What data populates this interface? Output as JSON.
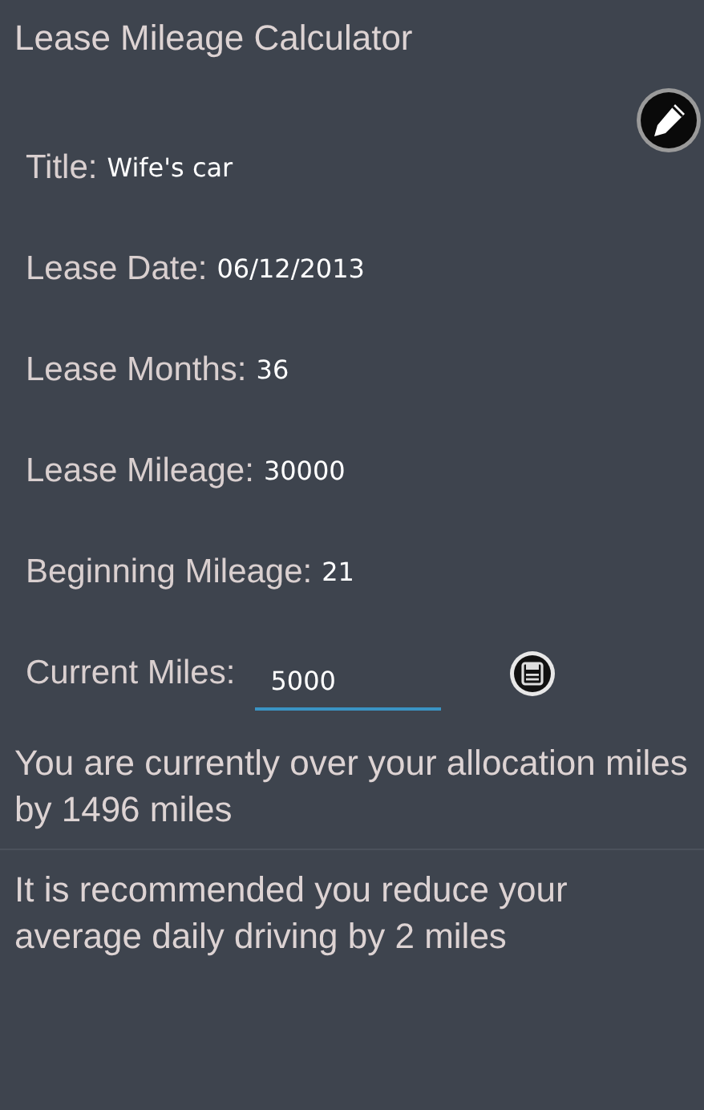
{
  "app_bar": {
    "title": "Lease Mileage Calculator"
  },
  "fields": [
    {
      "label": "Title:",
      "value": "Wife's car",
      "kind": "text"
    },
    {
      "label": "Lease Date:",
      "value": "06/12/2013",
      "kind": "text"
    },
    {
      "label": "Lease Months:",
      "value": "36",
      "kind": "text"
    },
    {
      "label": "Lease Mileage:",
      "value": "30000",
      "kind": "text"
    },
    {
      "label": "Beginning Mileage:",
      "value": "21",
      "kind": "text"
    },
    {
      "label": "Current Miles:",
      "value": "5000",
      "kind": "input"
    }
  ],
  "messages": [
    "You are currently over your allocation miles by 1496 miles",
    "It is recommended you reduce your average daily driving by 2 miles"
  ]
}
